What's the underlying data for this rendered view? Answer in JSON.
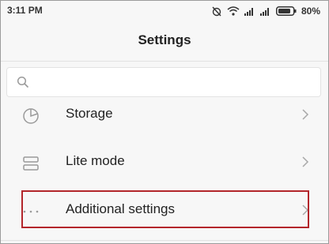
{
  "status_bar": {
    "time": "3:11 PM",
    "icons": [
      "alarm-off-icon",
      "wifi-icon",
      "signal-icon",
      "signal-icon",
      "battery-icon"
    ],
    "battery": "80%"
  },
  "header": {
    "title": "Settings"
  },
  "search": {
    "placeholder": "",
    "icon": "search-icon"
  },
  "items": [
    {
      "label": "Storage",
      "icon": "storage-pie-icon"
    },
    {
      "label": "Lite mode",
      "icon": "lite-mode-icon"
    },
    {
      "label": "Additional settings",
      "icon": "more-dots-icon",
      "highlighted": true
    }
  ],
  "colors": {
    "background": "#f7f7f7",
    "text": "#222222",
    "highlight": "#b3262b",
    "icon": "#9a9a9a"
  }
}
